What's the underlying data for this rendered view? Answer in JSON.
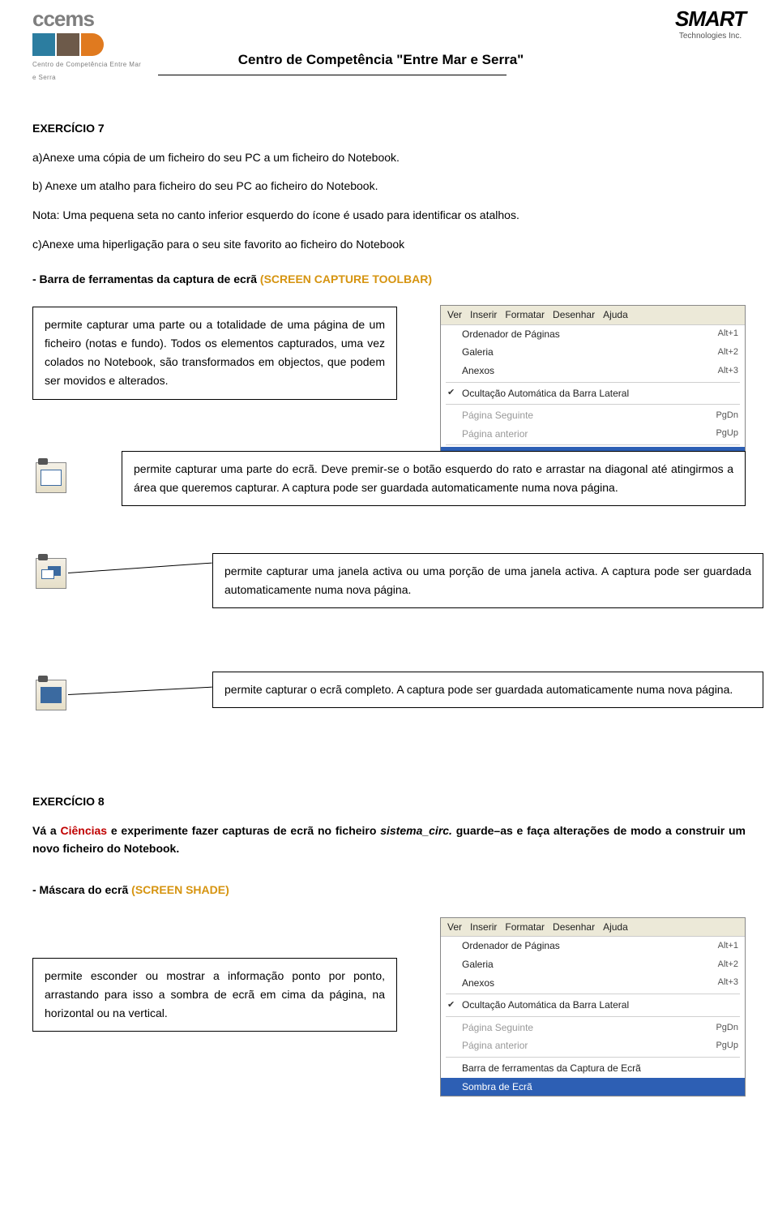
{
  "header": {
    "title": "Centro de Competência \"Entre Mar e Serra\"",
    "left_logo_text": "ccems",
    "left_logo_sub": "Centro de Competência Entre Mar e Serra",
    "right_logo_text": "SMART",
    "right_logo_sub": "Technologies Inc."
  },
  "ex7": {
    "heading": "EXERCÍCIO 7",
    "a": "a)Anexe uma cópia de um ficheiro do seu PC a um ficheiro do Notebook.",
    "b": "b) Anexe um atalho para ficheiro do seu PC ao ficheiro do Notebook.",
    "nota": "Nota: Uma pequena seta no canto inferior esquerdo do ícone é usado para identificar os atalhos.",
    "c": "c)Anexe uma hiperligação para o seu site favorito ao ficheiro do Notebook"
  },
  "barra": {
    "prefix": "- Barra de ferramentas da captura de ecrã ",
    "orange": "(SCREEN CAPTURE TOOLBAR)"
  },
  "capt": {
    "box1": "permite capturar uma parte ou a totalidade de uma página de um ficheiro (notas e fundo). Todos os elementos capturados, uma vez colados no Notebook, são transformados em objectos, que podem ser movidos e alterados.",
    "box2": "permite capturar uma parte do ecrã. Deve premir-se o botão esquerdo do rato e arrastar na diagonal até atingirmos a área que queremos capturar. A captura pode ser guardada automaticamente numa nova página.",
    "box3": "permite capturar uma janela activa ou uma porção de uma janela activa. A captura pode ser guardada automaticamente numa nova página.",
    "box4": "permite capturar o ecrã completo. A captura pode ser guardada automaticamente numa nova página."
  },
  "menu": {
    "bar": [
      "Ver",
      "Inserir",
      "Formatar",
      "Desenhar",
      "Ajuda"
    ],
    "items": [
      {
        "label": "Ordenador de Páginas",
        "sc": "Alt+1"
      },
      {
        "label": "Galeria",
        "sc": "Alt+2"
      },
      {
        "label": "Anexos",
        "sc": "Alt+3"
      }
    ],
    "auto": "Ocultação Automática da Barra Lateral",
    "pag_next": {
      "label": "Página Seguinte",
      "sc": "PgDn"
    },
    "pag_prev": {
      "label": "Página anterior",
      "sc": "PgUp"
    },
    "barra_cap": "Barra de ferramentas da Captura de Ecrã",
    "sombra": "Sombra de Ecrã"
  },
  "ex8": {
    "heading": "EXERCÍCIO 8",
    "pre": "Vá a ",
    "ciencias": "Ciências",
    "mid": " e experimente fazer capturas de ecrã no ficheiro ",
    "file": "sistema_circ.",
    "post": " guarde–as e faça alterações de modo a construir um novo ficheiro do Notebook."
  },
  "shade": {
    "prefix": "- Máscara do ecrã  ",
    "orange": "(SCREEN SHADE)",
    "box": "permite esconder ou mostrar a informação ponto por ponto, arrastando para isso a sombra de ecrã em cima da página, na horizontal ou na vertical."
  }
}
